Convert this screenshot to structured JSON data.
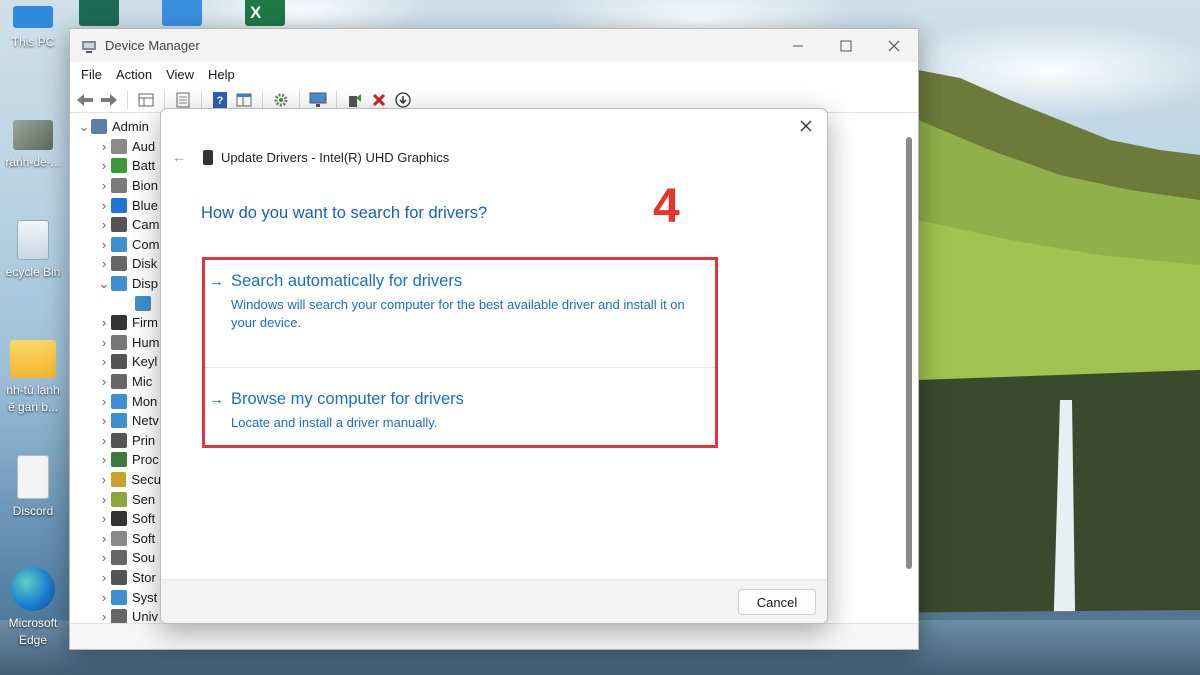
{
  "desktop": {
    "icons": [
      {
        "label": "This PC",
        "icon": "this-pc-icon"
      },
      {
        "label": "ranh-de-...",
        "icon": "image-file-icon"
      },
      {
        "label": "ecycle Bin",
        "icon": "recycle-bin-icon"
      },
      {
        "label": "nh-tủ lạnh\nẽ gàn b...",
        "icon": "folder-icon"
      },
      {
        "label": "Discord",
        "icon": "shortcut-file-icon"
      },
      {
        "label": "Microsoft\nEdge",
        "icon": "edge-icon"
      }
    ],
    "top_apps": [
      "pen-app-icon",
      "blue-app-icon",
      "excel-icon"
    ]
  },
  "device_manager": {
    "title": "Device Manager",
    "menu": [
      "File",
      "Action",
      "View",
      "Help"
    ],
    "toolbar": [
      "back-icon",
      "forward-icon",
      "properties-grid-icon",
      "document-icon",
      "help-icon",
      "view-icon",
      "update-gear-icon",
      "monitor-scan-icon",
      "enable-device-icon",
      "uninstall-x-icon",
      "download-circle-icon"
    ],
    "tree": [
      {
        "label": "Admin",
        "expand": "v",
        "indent": 0,
        "color": "#5b7fa8"
      },
      {
        "label": "Aud",
        "expand": ">",
        "indent": 1,
        "color": "#8a8a8a"
      },
      {
        "label": "Batt",
        "expand": ">",
        "indent": 1,
        "color": "#3a9a3a"
      },
      {
        "label": "Bion",
        "expand": ">",
        "indent": 1,
        "color": "#7a7a7a"
      },
      {
        "label": "Blue",
        "expand": ">",
        "indent": 1,
        "color": "#1f74d6"
      },
      {
        "label": "Cam",
        "expand": ">",
        "indent": 1,
        "color": "#555555"
      },
      {
        "label": "Com",
        "expand": ">",
        "indent": 1,
        "color": "#3d8fd1"
      },
      {
        "label": "Disk",
        "expand": ">",
        "indent": 1,
        "color": "#666666"
      },
      {
        "label": "Disp",
        "expand": "v",
        "indent": 1,
        "color": "#3d8fd1"
      },
      {
        "label": "",
        "expand": "",
        "indent": 2,
        "color": "#3d8fd1"
      },
      {
        "label": "Firm",
        "expand": ">",
        "indent": 1,
        "color": "#333333"
      },
      {
        "label": "Hum",
        "expand": ">",
        "indent": 1,
        "color": "#777777"
      },
      {
        "label": "Keyl",
        "expand": ">",
        "indent": 1,
        "color": "#555555"
      },
      {
        "label": "Mic",
        "expand": ">",
        "indent": 1,
        "color": "#666666"
      },
      {
        "label": "Mon",
        "expand": ">",
        "indent": 1,
        "color": "#3d8fd1"
      },
      {
        "label": "Netv",
        "expand": ">",
        "indent": 1,
        "color": "#3d8fd1"
      },
      {
        "label": "Prin",
        "expand": ">",
        "indent": 1,
        "color": "#555555"
      },
      {
        "label": "Proc",
        "expand": ">",
        "indent": 1,
        "color": "#3a7a3a"
      },
      {
        "label": "Secu",
        "expand": ">",
        "indent": 1,
        "color": "#c9a227"
      },
      {
        "label": "Sen",
        "expand": ">",
        "indent": 1,
        "color": "#8aa83a"
      },
      {
        "label": "Soft",
        "expand": ">",
        "indent": 1,
        "color": "#333333"
      },
      {
        "label": "Soft",
        "expand": ">",
        "indent": 1,
        "color": "#888888"
      },
      {
        "label": "Sou",
        "expand": ">",
        "indent": 1,
        "color": "#666666"
      },
      {
        "label": "Stor",
        "expand": ">",
        "indent": 1,
        "color": "#555555"
      },
      {
        "label": "Syst",
        "expand": ">",
        "indent": 1,
        "color": "#3d8fd1"
      },
      {
        "label": "Univ",
        "expand": ">",
        "indent": 1,
        "color": "#666666"
      }
    ]
  },
  "dialog": {
    "subtitle": "Update Drivers - Intel(R) UHD Graphics",
    "question": "How do you want to search for drivers?",
    "step_number": "4",
    "option_auto": {
      "title": "Search automatically for drivers",
      "description": "Windows will search your computer for the best available driver and install it on your device."
    },
    "option_browse": {
      "title": "Browse my computer for drivers",
      "description": "Locate and install a driver manually."
    },
    "cancel_label": "Cancel"
  },
  "colors": {
    "link_blue": "#1a6fc5",
    "highlight_red": "#e0353f",
    "step_red": "#e8342c"
  }
}
